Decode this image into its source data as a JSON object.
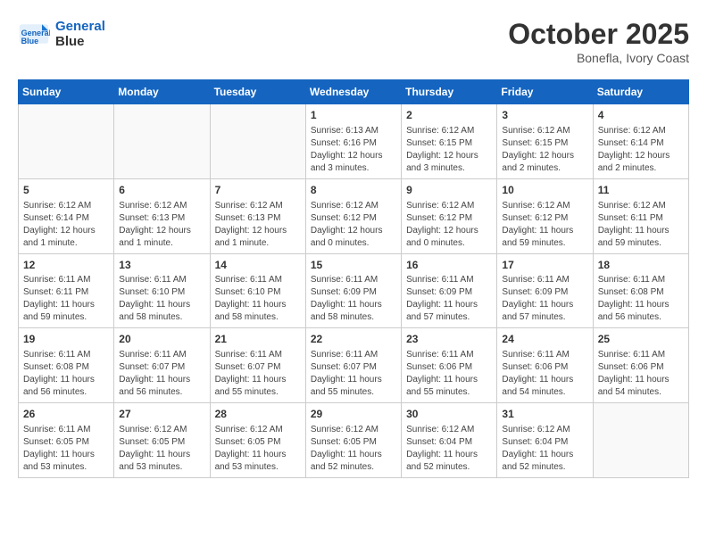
{
  "header": {
    "logo_line1": "General",
    "logo_line2": "Blue",
    "title": "October 2025",
    "subtitle": "Bonefla, Ivory Coast"
  },
  "weekdays": [
    "Sunday",
    "Monday",
    "Tuesday",
    "Wednesday",
    "Thursday",
    "Friday",
    "Saturday"
  ],
  "weeks": [
    [
      {
        "day": "",
        "empty": true
      },
      {
        "day": "",
        "empty": true
      },
      {
        "day": "",
        "empty": true
      },
      {
        "day": "1",
        "info": "Sunrise: 6:13 AM\nSunset: 6:16 PM\nDaylight: 12 hours\nand 3 minutes."
      },
      {
        "day": "2",
        "info": "Sunrise: 6:12 AM\nSunset: 6:15 PM\nDaylight: 12 hours\nand 3 minutes."
      },
      {
        "day": "3",
        "info": "Sunrise: 6:12 AM\nSunset: 6:15 PM\nDaylight: 12 hours\nand 2 minutes."
      },
      {
        "day": "4",
        "info": "Sunrise: 6:12 AM\nSunset: 6:14 PM\nDaylight: 12 hours\nand 2 minutes."
      }
    ],
    [
      {
        "day": "5",
        "info": "Sunrise: 6:12 AM\nSunset: 6:14 PM\nDaylight: 12 hours\nand 1 minute."
      },
      {
        "day": "6",
        "info": "Sunrise: 6:12 AM\nSunset: 6:13 PM\nDaylight: 12 hours\nand 1 minute."
      },
      {
        "day": "7",
        "info": "Sunrise: 6:12 AM\nSunset: 6:13 PM\nDaylight: 12 hours\nand 1 minute."
      },
      {
        "day": "8",
        "info": "Sunrise: 6:12 AM\nSunset: 6:12 PM\nDaylight: 12 hours\nand 0 minutes."
      },
      {
        "day": "9",
        "info": "Sunrise: 6:12 AM\nSunset: 6:12 PM\nDaylight: 12 hours\nand 0 minutes."
      },
      {
        "day": "10",
        "info": "Sunrise: 6:12 AM\nSunset: 6:12 PM\nDaylight: 11 hours\nand 59 minutes."
      },
      {
        "day": "11",
        "info": "Sunrise: 6:12 AM\nSunset: 6:11 PM\nDaylight: 11 hours\nand 59 minutes."
      }
    ],
    [
      {
        "day": "12",
        "info": "Sunrise: 6:11 AM\nSunset: 6:11 PM\nDaylight: 11 hours\nand 59 minutes."
      },
      {
        "day": "13",
        "info": "Sunrise: 6:11 AM\nSunset: 6:10 PM\nDaylight: 11 hours\nand 58 minutes."
      },
      {
        "day": "14",
        "info": "Sunrise: 6:11 AM\nSunset: 6:10 PM\nDaylight: 11 hours\nand 58 minutes."
      },
      {
        "day": "15",
        "info": "Sunrise: 6:11 AM\nSunset: 6:09 PM\nDaylight: 11 hours\nand 58 minutes."
      },
      {
        "day": "16",
        "info": "Sunrise: 6:11 AM\nSunset: 6:09 PM\nDaylight: 11 hours\nand 57 minutes."
      },
      {
        "day": "17",
        "info": "Sunrise: 6:11 AM\nSunset: 6:09 PM\nDaylight: 11 hours\nand 57 minutes."
      },
      {
        "day": "18",
        "info": "Sunrise: 6:11 AM\nSunset: 6:08 PM\nDaylight: 11 hours\nand 56 minutes."
      }
    ],
    [
      {
        "day": "19",
        "info": "Sunrise: 6:11 AM\nSunset: 6:08 PM\nDaylight: 11 hours\nand 56 minutes."
      },
      {
        "day": "20",
        "info": "Sunrise: 6:11 AM\nSunset: 6:07 PM\nDaylight: 11 hours\nand 56 minutes."
      },
      {
        "day": "21",
        "info": "Sunrise: 6:11 AM\nSunset: 6:07 PM\nDaylight: 11 hours\nand 55 minutes."
      },
      {
        "day": "22",
        "info": "Sunrise: 6:11 AM\nSunset: 6:07 PM\nDaylight: 11 hours\nand 55 minutes."
      },
      {
        "day": "23",
        "info": "Sunrise: 6:11 AM\nSunset: 6:06 PM\nDaylight: 11 hours\nand 55 minutes."
      },
      {
        "day": "24",
        "info": "Sunrise: 6:11 AM\nSunset: 6:06 PM\nDaylight: 11 hours\nand 54 minutes."
      },
      {
        "day": "25",
        "info": "Sunrise: 6:11 AM\nSunset: 6:06 PM\nDaylight: 11 hours\nand 54 minutes."
      }
    ],
    [
      {
        "day": "26",
        "info": "Sunrise: 6:11 AM\nSunset: 6:05 PM\nDaylight: 11 hours\nand 53 minutes."
      },
      {
        "day": "27",
        "info": "Sunrise: 6:12 AM\nSunset: 6:05 PM\nDaylight: 11 hours\nand 53 minutes."
      },
      {
        "day": "28",
        "info": "Sunrise: 6:12 AM\nSunset: 6:05 PM\nDaylight: 11 hours\nand 53 minutes."
      },
      {
        "day": "29",
        "info": "Sunrise: 6:12 AM\nSunset: 6:05 PM\nDaylight: 11 hours\nand 52 minutes."
      },
      {
        "day": "30",
        "info": "Sunrise: 6:12 AM\nSunset: 6:04 PM\nDaylight: 11 hours\nand 52 minutes."
      },
      {
        "day": "31",
        "info": "Sunrise: 6:12 AM\nSunset: 6:04 PM\nDaylight: 11 hours\nand 52 minutes."
      },
      {
        "day": "",
        "empty": true
      }
    ]
  ]
}
